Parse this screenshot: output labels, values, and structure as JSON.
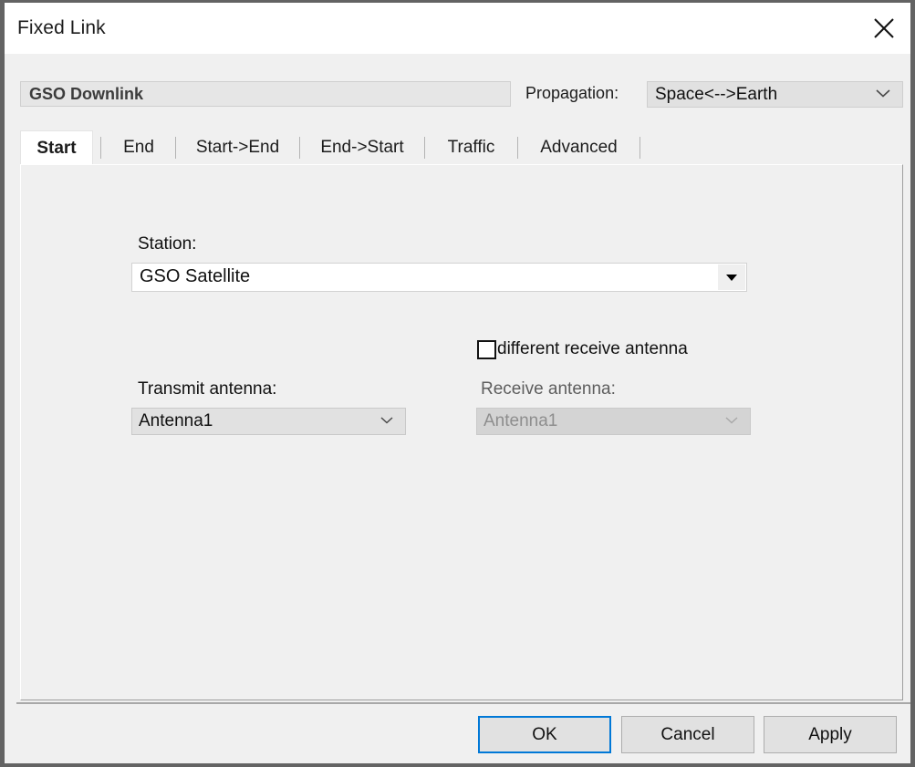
{
  "window": {
    "title": "Fixed Link",
    "close_icon": "close-icon"
  },
  "header": {
    "link_name": "GSO Downlink",
    "propagation_label": "Propagation:",
    "propagation_value": "Space<-->Earth",
    "propagation_options": [
      "Space<-->Earth"
    ],
    "dropdown_icon": "chevron-down-icon"
  },
  "tabs": {
    "items": [
      {
        "label": "Start",
        "active": true
      },
      {
        "label": "End",
        "active": false
      },
      {
        "label": "Start->End",
        "active": false
      },
      {
        "label": "End->Start",
        "active": false
      },
      {
        "label": "Traffic",
        "active": false
      },
      {
        "label": "Advanced",
        "active": false
      }
    ]
  },
  "start_tab": {
    "station_label": "Station:",
    "station_value": "GSO Satellite",
    "station_options": [
      "GSO Satellite"
    ],
    "station_dropdown_icon": "triangle-down-icon",
    "different_receive_antenna_label": "different receive antenna",
    "different_receive_antenna_checked": false,
    "transmit_antenna_label": "Transmit antenna:",
    "transmit_antenna_value": "Antenna1",
    "transmit_antenna_options": [
      "Antenna1"
    ],
    "receive_antenna_label": "Receive antenna:",
    "receive_antenna_value": "Antenna1",
    "receive_antenna_options": [
      "Antenna1"
    ],
    "receive_antenna_enabled": false
  },
  "footer": {
    "ok_label": "OK",
    "cancel_label": "Cancel",
    "apply_label": "Apply"
  },
  "colors": {
    "accent": "#0078d7",
    "window_bg": "#f0f0f0",
    "titlebar_bg": "#ffffff",
    "frame": "#636363",
    "disabled_text": "#8e8e8e"
  }
}
